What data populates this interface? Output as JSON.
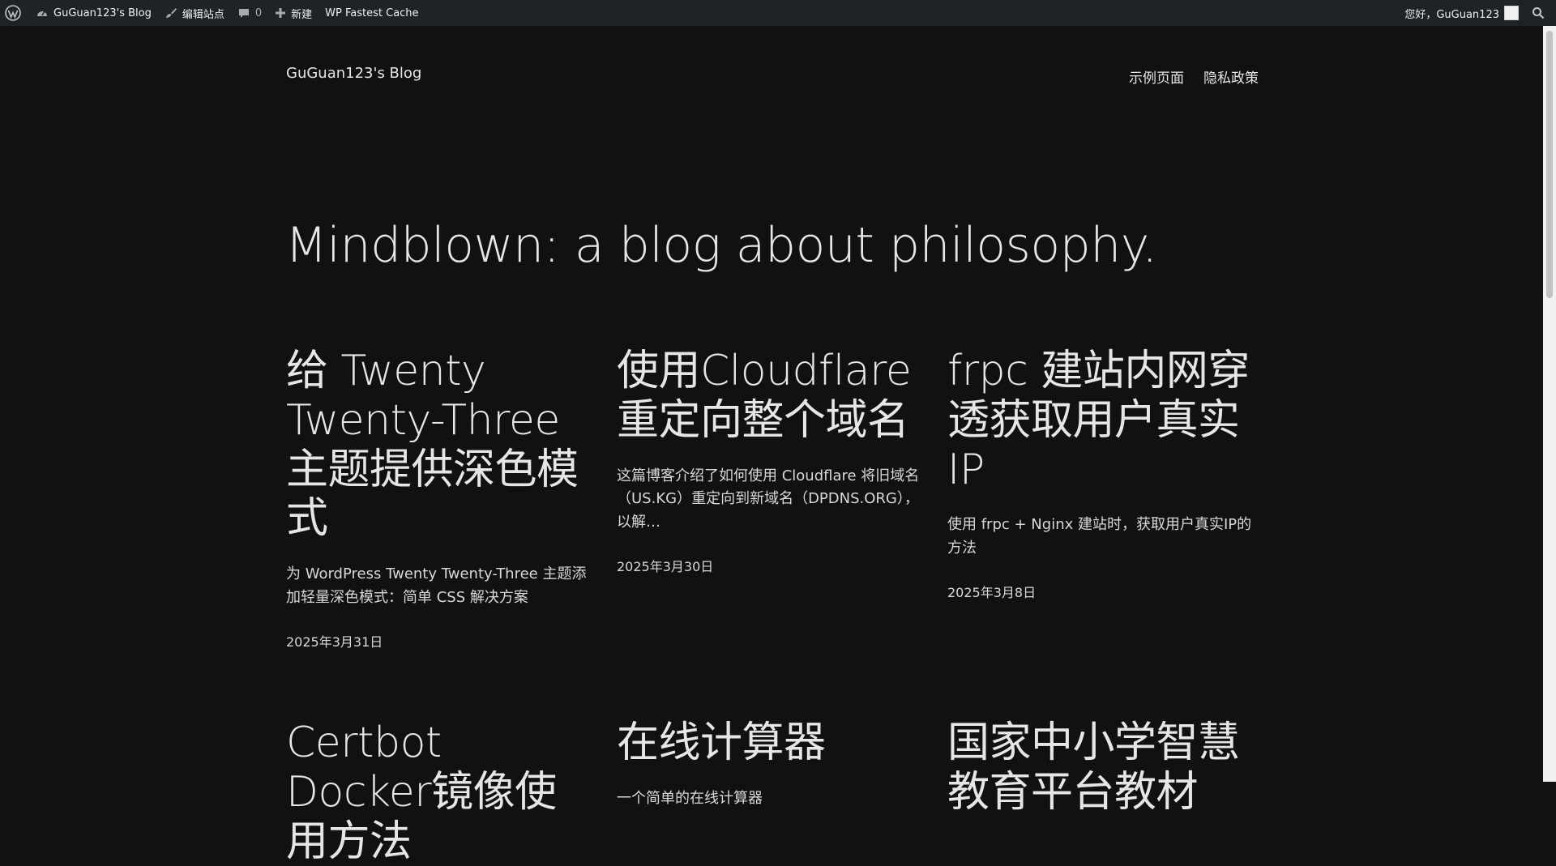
{
  "adminbar": {
    "site_name": "GuGuan123's Blog",
    "edit_site": "编辑站点",
    "comments_count": "0",
    "new_label": "新建",
    "cache_label": "WP Fastest Cache",
    "greeting": "您好，GuGuan123"
  },
  "header": {
    "site_title": "GuGuan123's Blog",
    "nav": [
      "示例页面",
      "隐私政策"
    ]
  },
  "hero": {
    "title": "Mindblown: a blog about philosophy."
  },
  "posts": [
    {
      "title": "给 Twenty Twenty-Three 主题提供深色模式",
      "excerpt": "为 WordPress Twenty Twenty-Three 主题添加轻量深色模式：简单 CSS 解决方案",
      "date": "2025年3月31日"
    },
    {
      "title": "使用Cloudflare重定向整个域名",
      "excerpt": "这篇博客介绍了如何使用 Cloudflare 将旧域名（US.KG）重定向到新域名（DPDNS.ORG），以解…",
      "date": "2025年3月30日"
    },
    {
      "title": "frpc 建站内网穿透获取用户真实IP",
      "excerpt": "使用 frpc + Nginx 建站时，获取用户真实IP的方法",
      "date": "2025年3月8日"
    },
    {
      "title": "Certbot Docker镜像使用方法",
      "excerpt": "",
      "date": ""
    },
    {
      "title": "在线计算器",
      "excerpt": "一个简单的在线计算器",
      "date": ""
    },
    {
      "title": "国家中小学智慧教育平台教材",
      "excerpt": "",
      "date": ""
    }
  ],
  "colors": {
    "background": "#111111",
    "adminbar": "#1d2327",
    "text": "#e6e6e6"
  }
}
